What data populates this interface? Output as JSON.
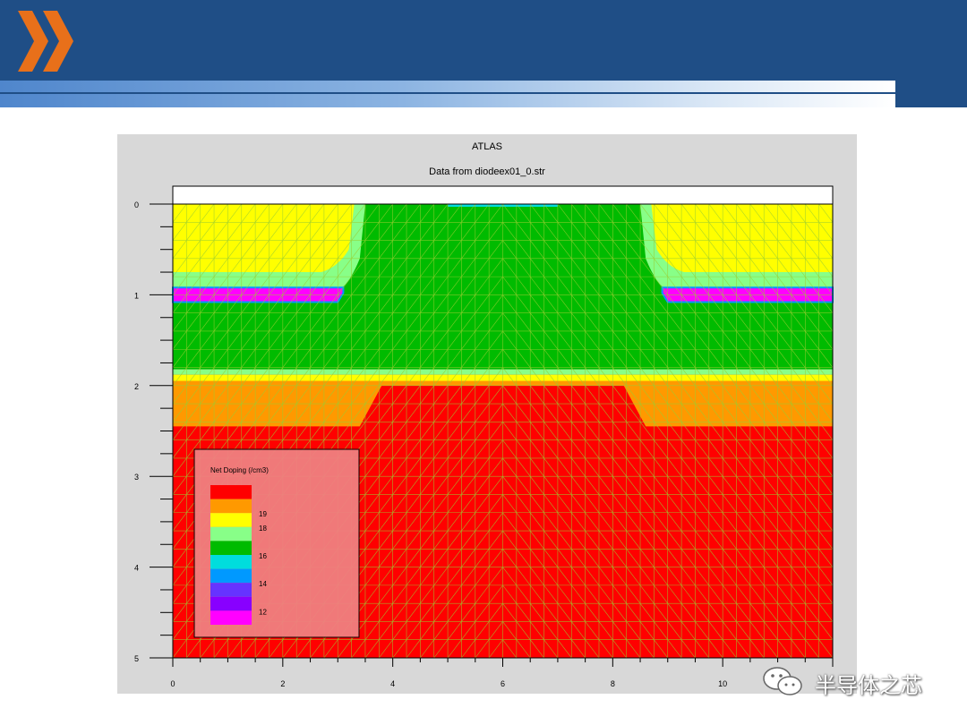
{
  "colors": {
    "header": "#1f4e86",
    "logo": "#e8701a",
    "plot_bg": "#d8d8d8",
    "mesh": "#9acd32"
  },
  "watermark": {
    "text": "半导体之芯",
    "icon": "wechat-icon"
  },
  "chart_data": {
    "type": "heatmap",
    "title": "ATLAS",
    "subtitle": "Data from diodeex01_0.str",
    "xlim": [
      0,
      12
    ],
    "ylim": [
      0,
      5
    ],
    "x_ticks": [
      "0",
      "2",
      "4",
      "6",
      "8",
      "10"
    ],
    "y_ticks": [
      "0",
      "1",
      "2",
      "3",
      "4",
      "5"
    ],
    "grid": false,
    "legend_position": "bottom-left",
    "legend": {
      "title": "Net Doping (/cm3)",
      "labels": [
        "19",
        "18",
        "16",
        "14",
        "12"
      ],
      "colors": [
        "#ff0000",
        "#ff9900",
        "#ffff00",
        "#88ff88",
        "#00bb00",
        "#00dddd",
        "#0099ff",
        "#6633ff",
        "#8800ff",
        "#ff00ff"
      ]
    },
    "regions": [
      {
        "name": "top-left p-region",
        "color": "#ffff00"
      },
      {
        "name": "top-right p-region",
        "color": "#ffff00"
      },
      {
        "name": "central n-region",
        "color": "#00bb00"
      },
      {
        "name": "left buried layer",
        "color": "#ff00ff"
      },
      {
        "name": "right buried layer",
        "color": "#ff00ff"
      },
      {
        "name": "substrate",
        "color": "#ff0000"
      },
      {
        "name": "transition band",
        "color": "#ff9900"
      }
    ]
  }
}
